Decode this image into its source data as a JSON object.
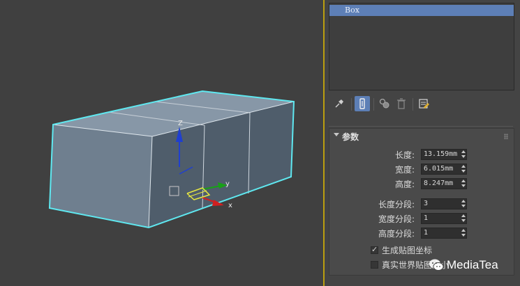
{
  "modifier_stack": {
    "items": [
      {
        "label": "Box",
        "selected": true
      }
    ]
  },
  "toolbar": {
    "buttons": [
      {
        "icon": "pin-stack-icon",
        "active": false
      },
      {
        "icon": "show-end-result-icon",
        "active": true
      },
      {
        "icon": "make-unique-icon",
        "active": false
      },
      {
        "icon": "remove-modifier-icon",
        "active": false
      },
      {
        "icon": "configure-modifier-sets-icon",
        "active": false
      }
    ]
  },
  "parameters": {
    "title": "参数",
    "fields": [
      {
        "label": "长度:",
        "value": "13.159mm"
      },
      {
        "label": "宽度:",
        "value": "6.015mm"
      },
      {
        "label": "高度:",
        "value": "8.247mm"
      }
    ],
    "segments": [
      {
        "label": "长度分段:",
        "value": "3"
      },
      {
        "label": "宽度分段:",
        "value": "1"
      },
      {
        "label": "高度分段:",
        "value": "1"
      }
    ],
    "checkboxes": [
      {
        "label": "生成贴图坐标",
        "checked": true
      },
      {
        "label": "真实世界贴图大小",
        "checked": false
      }
    ]
  },
  "viewport": {
    "object": "box",
    "gizmo_axes": [
      {
        "label": "Z",
        "color": "#1f3fd0"
      },
      {
        "label": "y",
        "color": "#18a018"
      },
      {
        "label": "x",
        "color": "#d02020"
      }
    ],
    "selection_color": "#5fe8f0"
  },
  "watermark": {
    "text": "MediaTea"
  }
}
